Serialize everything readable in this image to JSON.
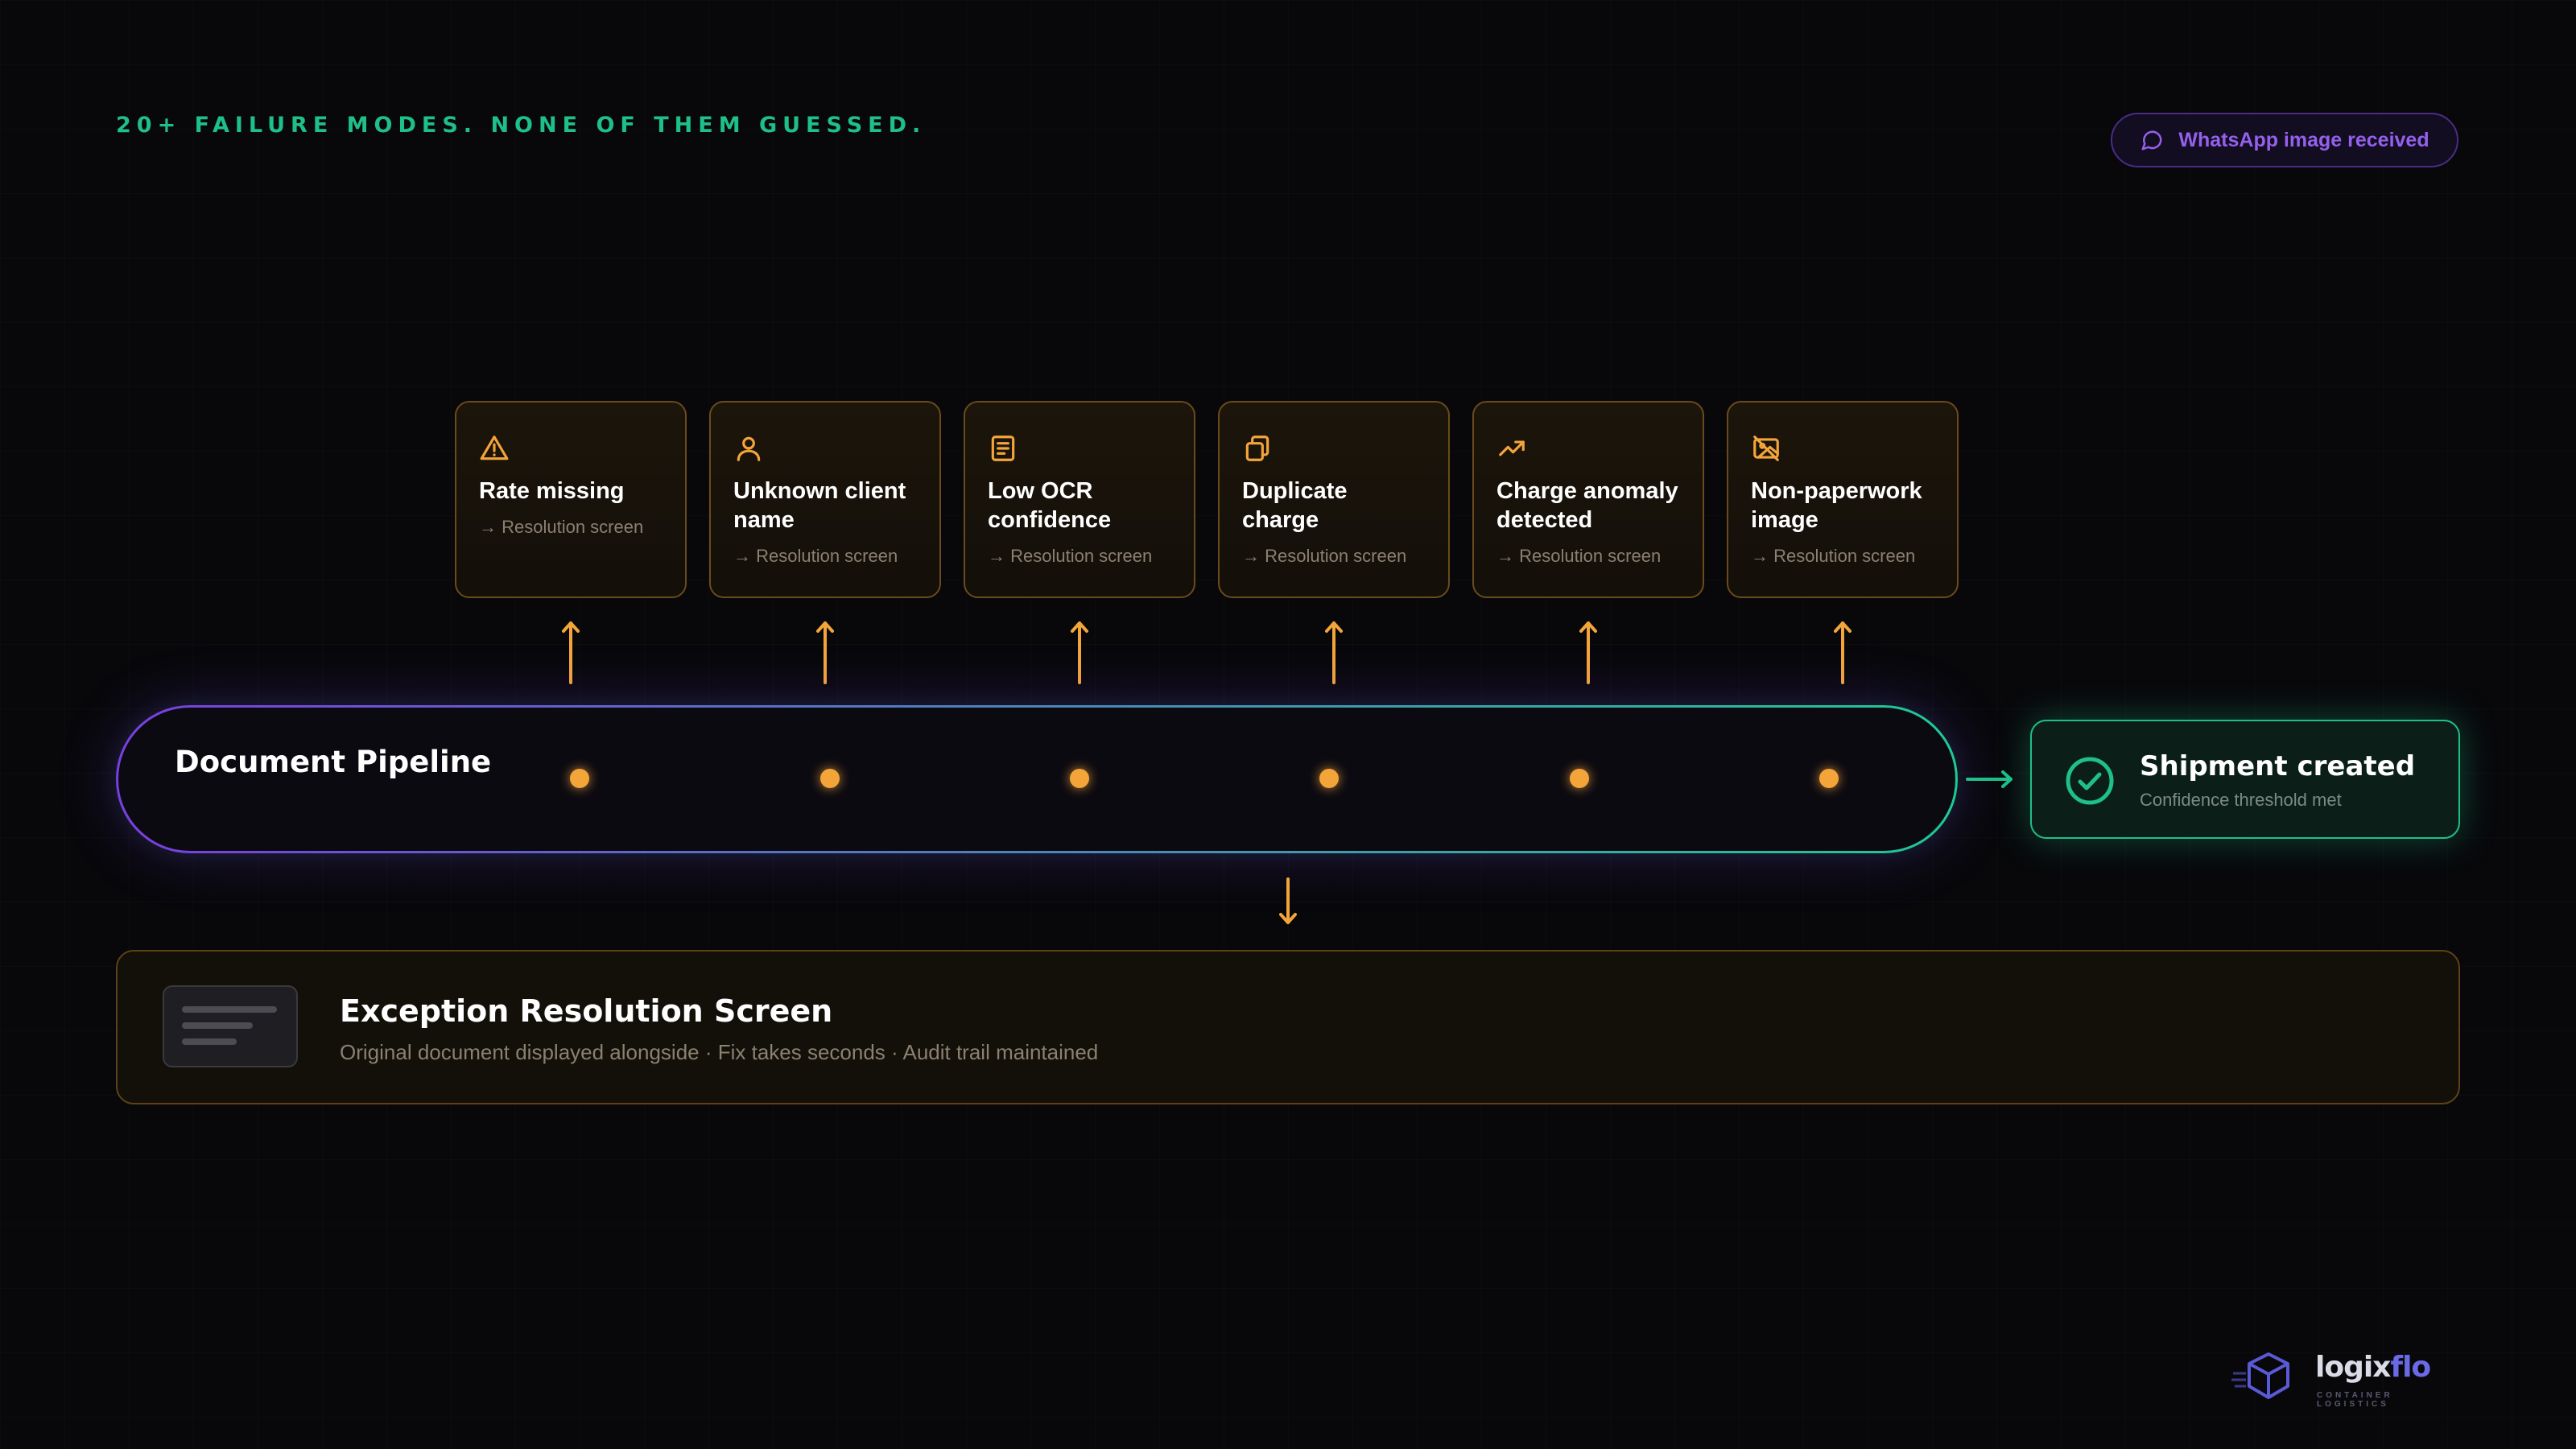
{
  "header": {
    "eyebrow": "20+ FAILURE MODES. NONE OF THEM GUESSED.",
    "pill": {
      "label": "WhatsApp image received",
      "icon": "chat-bubble-icon"
    }
  },
  "failure_cards": [
    {
      "icon": "warning-triangle-icon",
      "title": "Rate missing",
      "sub": "→ Resolution screen"
    },
    {
      "icon": "user-icon",
      "title": "Unknown client name",
      "sub": "→ Resolution screen"
    },
    {
      "icon": "document-icon",
      "title": "Low OCR confidence",
      "sub": "→ Resolution screen"
    },
    {
      "icon": "copy-icon",
      "title": "Duplicate charge",
      "sub": "→ Resolution screen"
    },
    {
      "icon": "trending-up-icon",
      "title": "Charge anomaly detected",
      "sub": "→ Resolution screen"
    },
    {
      "icon": "image-off-icon",
      "title": "Non-paperwork image",
      "sub": "→ Resolution screen"
    }
  ],
  "pipeline": {
    "title": "Document Pipeline"
  },
  "shipment": {
    "title": "Shipment created",
    "sub": "Confidence threshold met",
    "icon": "check-circle-icon"
  },
  "exception": {
    "title": "Exception Resolution Screen",
    "sub": "Original document displayed alongside · Fix takes seconds · Audit trail maintained",
    "icon": "document-thumbnail-icon"
  },
  "brand": {
    "name_part1": "logix",
    "name_part2": "flo",
    "tagline": "CONTAINER LOGISTICS",
    "icon": "cube-logo-icon"
  },
  "colors": {
    "accent_green": "#1fbf88",
    "accent_purple": "#9460ec",
    "accent_orange": "#f4a53a",
    "background": "#08080b"
  }
}
